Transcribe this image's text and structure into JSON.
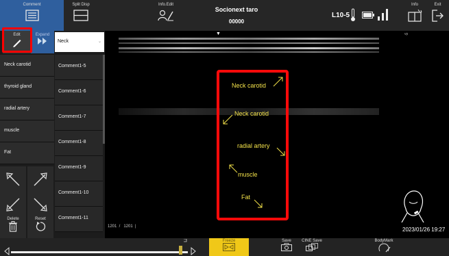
{
  "topbar": {
    "comment_label": "Comment",
    "split_disp_label": "Split Disp",
    "info_edit_label": "Info.Edit",
    "patient_name": "Socionext taro",
    "patient_id": "00000",
    "probe": "L10-5",
    "info_label": "Info",
    "exit_label": "Exit"
  },
  "leftpanel": {
    "edit_label": "Edit",
    "expand_label": "Expand",
    "category_selected": "Neck",
    "words": [
      "Neck carotid",
      "thyroid gland",
      "radial artery",
      "muscle",
      "Fat"
    ],
    "comments": [
      "Comment1-5",
      "Comment1-6",
      "Comment1-7",
      "Comment1-8",
      "Comment1-9",
      "Comment1-10",
      "Comment1-11"
    ],
    "delete_label": "Delete",
    "reset_label": "Reset"
  },
  "image": {
    "vp_label": "vp",
    "coord_readout": "1201  /   1201  |",
    "datetime": "2023/01/26 19:27",
    "annotations": [
      "Neck carotid",
      "Neck carotid",
      "radial artery",
      "muscle",
      "Fat"
    ]
  },
  "bottombar": {
    "freeze_label": "Freeze",
    "save_label": "Save",
    "cine_save_label": "CINE Save",
    "bodymark_label": "BodyMark",
    "cine_position": 0.97
  },
  "colors": {
    "accent_blue": "#2f5f9e",
    "highlight_red": "#ff0000",
    "annotation_yellow": "#f3e24a",
    "freeze_yellow": "#f0c818"
  },
  "icons": [
    "comment-icon",
    "split-display-icon",
    "info-edit-icon",
    "thermometer-icon",
    "battery-icon",
    "signal-icon",
    "info-book-icon",
    "exit-icon",
    "pencil-icon",
    "expand-icon",
    "trash-icon",
    "reset-icon",
    "body-mark-icon",
    "camera-icon",
    "cine-save-icon",
    "freeze-icon"
  ]
}
